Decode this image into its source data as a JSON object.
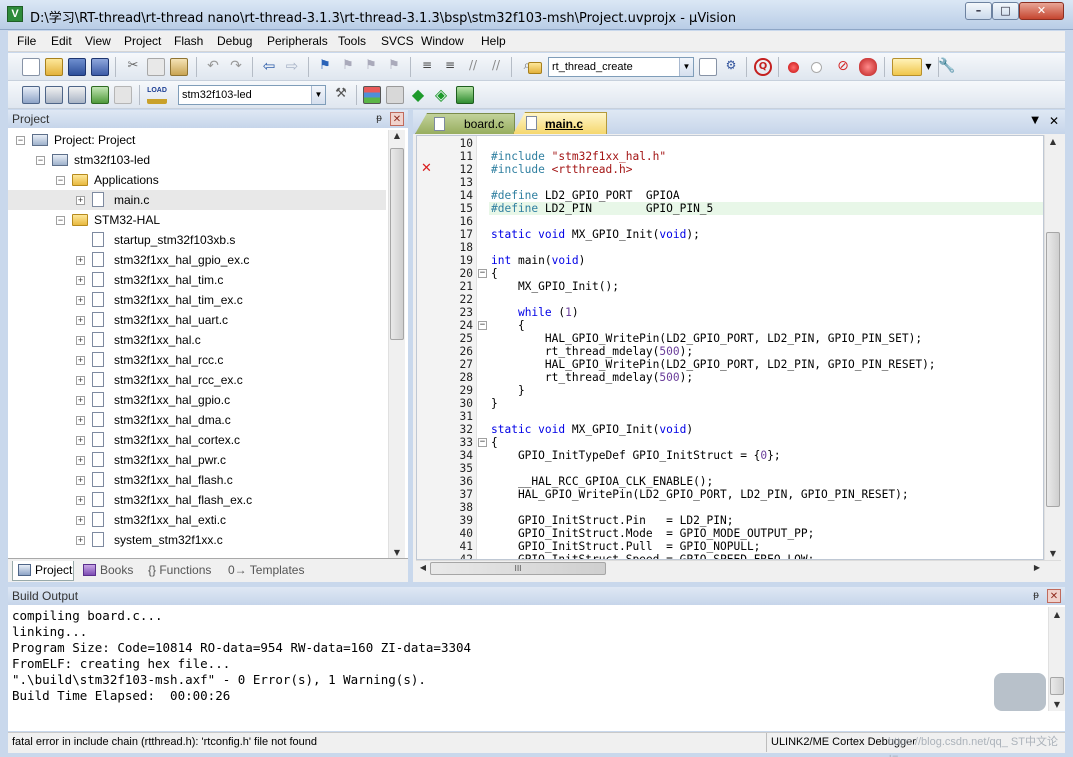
{
  "window": {
    "title": "D:\\学习\\RT-thread\\rt-thread nano\\rt-thread-3.1.3\\rt-thread-3.1.3\\bsp\\stm32f103-msh\\Project.uvprojx - µVision",
    "icon_letter": "V",
    "controls": {
      "minimize": "–",
      "maximize": "□",
      "close": "✕"
    }
  },
  "menu": [
    "File",
    "Edit",
    "View",
    "Project",
    "Flash",
    "Debug",
    "Peripherals",
    "Tools",
    "SVCS",
    "Window",
    "Help"
  ],
  "toolbar1": {
    "find_combo": "rt_thread_create",
    "icons": [
      "new-file-icon",
      "open-file-icon",
      "save-icon",
      "save-all-icon",
      "cut-icon",
      "copy-icon",
      "paste-icon",
      "undo-icon",
      "redo-icon",
      "navigate-back-icon",
      "navigate-forward-icon",
      "insert-bookmark-icon",
      "prev-bookmark-icon",
      "next-bookmark-icon",
      "clear-bookmarks-icon",
      "indent-icon",
      "unindent-icon",
      "comment-icon",
      "uncomment-icon",
      "find-in-files-icon",
      "incremental-find-icon",
      "start-debug-icon",
      "breakpoint-icon",
      "disable-breakpoint-icon",
      "kill-breakpoints-icon",
      "clear-breakpoints-icon",
      "window-layout-icon",
      "configure-icon"
    ]
  },
  "toolbar2": {
    "target_combo": "stm32f103-led",
    "icons": [
      "translate-icon",
      "build-icon",
      "rebuild-icon",
      "batch-build-icon",
      "stop-build-icon",
      "download-icon",
      "target-options-icon",
      "manage-components-icon",
      "file-extensions-icon",
      "run-time-environment-icon",
      "pack-installer-icon"
    ],
    "download_label": "LOAD"
  },
  "project_panel": {
    "title": "Project",
    "pin": "ᵽ",
    "close": "✕",
    "tree": [
      {
        "label": "Project: Project",
        "kind": "project",
        "level": 0,
        "expander": "−"
      },
      {
        "label": "stm32f103-led",
        "kind": "target",
        "level": 1,
        "expander": "−"
      },
      {
        "label": "Applications",
        "kind": "folder",
        "level": 2,
        "expander": "−"
      },
      {
        "label": "main.c",
        "kind": "file",
        "level": 3,
        "expander": "+",
        "selected": true
      },
      {
        "label": "STM32-HAL",
        "kind": "folder",
        "level": 2,
        "expander": "−"
      },
      {
        "label": "startup_stm32f103xb.s",
        "kind": "file",
        "level": 3,
        "expander": ""
      },
      {
        "label": "stm32f1xx_hal_gpio_ex.c",
        "kind": "file",
        "level": 3,
        "expander": "+"
      },
      {
        "label": "stm32f1xx_hal_tim.c",
        "kind": "file",
        "level": 3,
        "expander": "+"
      },
      {
        "label": "stm32f1xx_hal_tim_ex.c",
        "kind": "file",
        "level": 3,
        "expander": "+"
      },
      {
        "label": "stm32f1xx_hal_uart.c",
        "kind": "file",
        "level": 3,
        "expander": "+"
      },
      {
        "label": "stm32f1xx_hal.c",
        "kind": "file",
        "level": 3,
        "expander": "+"
      },
      {
        "label": "stm32f1xx_hal_rcc.c",
        "kind": "file",
        "level": 3,
        "expander": "+"
      },
      {
        "label": "stm32f1xx_hal_rcc_ex.c",
        "kind": "file",
        "level": 3,
        "expander": "+"
      },
      {
        "label": "stm32f1xx_hal_gpio.c",
        "kind": "file",
        "level": 3,
        "expander": "+"
      },
      {
        "label": "stm32f1xx_hal_dma.c",
        "kind": "file",
        "level": 3,
        "expander": "+"
      },
      {
        "label": "stm32f1xx_hal_cortex.c",
        "kind": "file",
        "level": 3,
        "expander": "+"
      },
      {
        "label": "stm32f1xx_hal_pwr.c",
        "kind": "file",
        "level": 3,
        "expander": "+"
      },
      {
        "label": "stm32f1xx_hal_flash.c",
        "kind": "file",
        "level": 3,
        "expander": "+"
      },
      {
        "label": "stm32f1xx_hal_flash_ex.c",
        "kind": "file",
        "level": 3,
        "expander": "+"
      },
      {
        "label": "stm32f1xx_hal_exti.c",
        "kind": "file",
        "level": 3,
        "expander": "+"
      },
      {
        "label": "system_stm32f1xx.c",
        "kind": "file",
        "level": 3,
        "expander": "+"
      }
    ],
    "tabs": [
      {
        "label": "Project",
        "active": true,
        "icon": "project-tab-icon"
      },
      {
        "label": "Books",
        "active": false,
        "icon": "books-tab-icon"
      },
      {
        "label": "{} Functions",
        "active": false,
        "icon": "functions-tab-icon"
      },
      {
        "label": "0→ Templates",
        "active": false,
        "icon": "templates-tab-icon"
      }
    ]
  },
  "editor": {
    "tabs": [
      {
        "label": "board.c",
        "active": false
      },
      {
        "label": "main.c",
        "active": true
      }
    ],
    "tab_menu": "▼",
    "tab_close": "✕",
    "error_line": 12,
    "highlight_line": 15,
    "lines": [
      {
        "n": 10,
        "html": ""
      },
      {
        "n": 11,
        "html": "<span class=\"pp\">#include</span> <span class=\"s\">\"stm32f1xx_hal.h\"</span>"
      },
      {
        "n": 12,
        "html": "<span class=\"pp\">#include</span> <span class=\"s\">&lt;rtthread.h&gt;</span>"
      },
      {
        "n": 13,
        "html": ""
      },
      {
        "n": 14,
        "html": "<span class=\"pp\">#define</span> LD2_GPIO_PORT  GPIOA"
      },
      {
        "n": 15,
        "html": "<span class=\"pp\">#define</span> LD2_PIN        GPIO_PIN_5"
      },
      {
        "n": 16,
        "html": ""
      },
      {
        "n": 17,
        "html": "<span class=\"k\">static</span> <span class=\"k\">void</span> MX_GPIO_Init(<span class=\"k\">void</span>);"
      },
      {
        "n": 18,
        "html": ""
      },
      {
        "n": 19,
        "html": "<span class=\"k\">int</span> main(<span class=\"k\">void</span>)"
      },
      {
        "n": 20,
        "html": "{",
        "fold": true
      },
      {
        "n": 21,
        "html": "    MX_GPIO_Init();"
      },
      {
        "n": 22,
        "html": ""
      },
      {
        "n": 23,
        "html": "    <span class=\"k\">while</span> (<span class=\"n\">1</span>)"
      },
      {
        "n": 24,
        "html": "    {",
        "fold": true
      },
      {
        "n": 25,
        "html": "        HAL_GPIO_WritePin(LD2_GPIO_PORT, LD2_PIN, GPIO_PIN_SET);"
      },
      {
        "n": 26,
        "html": "        rt_thread_mdelay(<span class=\"n\">500</span>);"
      },
      {
        "n": 27,
        "html": "        HAL_GPIO_WritePin(LD2_GPIO_PORT, LD2_PIN, GPIO_PIN_RESET);"
      },
      {
        "n": 28,
        "html": "        rt_thread_mdelay(<span class=\"n\">500</span>);"
      },
      {
        "n": 29,
        "html": "    }"
      },
      {
        "n": 30,
        "html": "}"
      },
      {
        "n": 31,
        "html": ""
      },
      {
        "n": 32,
        "html": "<span class=\"k\">static</span> <span class=\"k\">void</span> MX_GPIO_Init(<span class=\"k\">void</span>)"
      },
      {
        "n": 33,
        "html": "{",
        "fold": true
      },
      {
        "n": 34,
        "html": "    GPIO_InitTypeDef GPIO_InitStruct = {<span class=\"n\">0</span>};"
      },
      {
        "n": 35,
        "html": ""
      },
      {
        "n": 36,
        "html": "    __HAL_RCC_GPIOA_CLK_ENABLE();"
      },
      {
        "n": 37,
        "html": "    HAL_GPIO_WritePin(LD2_GPIO_PORT, LD2_PIN, GPIO_PIN_RESET);"
      },
      {
        "n": 38,
        "html": ""
      },
      {
        "n": 39,
        "html": "    GPIO_InitStruct.Pin   = LD2_PIN;"
      },
      {
        "n": 40,
        "html": "    GPIO_InitStruct.Mode  = GPIO_MODE_OUTPUT_PP;"
      },
      {
        "n": 41,
        "html": "    GPIO_InitStruct.Pull  = GPIO_NOPULL;"
      },
      {
        "n": 42,
        "html": "    GPIO_InitStruct.Speed = GPIO_SPEED_FREQ_LOW;"
      }
    ],
    "hscroll_grip": "III"
  },
  "build_output": {
    "title": "Build Output",
    "pin": "ᵽ",
    "close": "✕",
    "lines": [
      "compiling board.c...",
      "linking...",
      "Program Size: Code=10814 RO-data=954 RW-data=160 ZI-data=3304",
      "FromELF: creating hex file...",
      "\".\\build\\stm32f103-msh.axf\" - 0 Error(s), 1 Warning(s).",
      "Build Time Elapsed:  00:00:26"
    ]
  },
  "status": {
    "message": "fatal error in include chain (rtthread.h): 'rtconfig.h' file not found",
    "debugger": "ULINK2/ME Cortex Debugger",
    "watermark": "https://blog.csdn.net/qq_  ST中文论坛"
  },
  "colors": {
    "accent": "#f5d76e",
    "highlight_line": "#e8f7e8",
    "error": "#d91e1e",
    "toolbar": "#dfe6ef"
  }
}
